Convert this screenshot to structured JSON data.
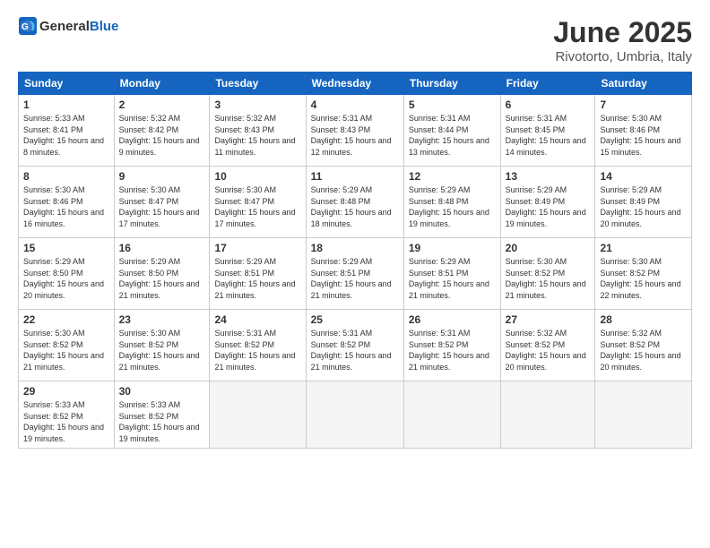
{
  "logo": {
    "general": "General",
    "blue": "Blue"
  },
  "title": "June 2025",
  "location": "Rivotorto, Umbria, Italy",
  "headers": [
    "Sunday",
    "Monday",
    "Tuesday",
    "Wednesday",
    "Thursday",
    "Friday",
    "Saturday"
  ],
  "weeks": [
    [
      {
        "day": "1",
        "rise": "5:33 AM",
        "set": "8:41 PM",
        "daylight": "15 hours and 8 minutes."
      },
      {
        "day": "2",
        "rise": "5:32 AM",
        "set": "8:42 PM",
        "daylight": "15 hours and 9 minutes."
      },
      {
        "day": "3",
        "rise": "5:32 AM",
        "set": "8:43 PM",
        "daylight": "15 hours and 11 minutes."
      },
      {
        "day": "4",
        "rise": "5:31 AM",
        "set": "8:43 PM",
        "daylight": "15 hours and 12 minutes."
      },
      {
        "day": "5",
        "rise": "5:31 AM",
        "set": "8:44 PM",
        "daylight": "15 hours and 13 minutes."
      },
      {
        "day": "6",
        "rise": "5:31 AM",
        "set": "8:45 PM",
        "daylight": "15 hours and 14 minutes."
      },
      {
        "day": "7",
        "rise": "5:30 AM",
        "set": "8:46 PM",
        "daylight": "15 hours and 15 minutes."
      }
    ],
    [
      {
        "day": "8",
        "rise": "5:30 AM",
        "set": "8:46 PM",
        "daylight": "15 hours and 16 minutes."
      },
      {
        "day": "9",
        "rise": "5:30 AM",
        "set": "8:47 PM",
        "daylight": "15 hours and 17 minutes."
      },
      {
        "day": "10",
        "rise": "5:30 AM",
        "set": "8:47 PM",
        "daylight": "15 hours and 17 minutes."
      },
      {
        "day": "11",
        "rise": "5:29 AM",
        "set": "8:48 PM",
        "daylight": "15 hours and 18 minutes."
      },
      {
        "day": "12",
        "rise": "5:29 AM",
        "set": "8:48 PM",
        "daylight": "15 hours and 19 minutes."
      },
      {
        "day": "13",
        "rise": "5:29 AM",
        "set": "8:49 PM",
        "daylight": "15 hours and 19 minutes."
      },
      {
        "day": "14",
        "rise": "5:29 AM",
        "set": "8:49 PM",
        "daylight": "15 hours and 20 minutes."
      }
    ],
    [
      {
        "day": "15",
        "rise": "5:29 AM",
        "set": "8:50 PM",
        "daylight": "15 hours and 20 minutes."
      },
      {
        "day": "16",
        "rise": "5:29 AM",
        "set": "8:50 PM",
        "daylight": "15 hours and 21 minutes."
      },
      {
        "day": "17",
        "rise": "5:29 AM",
        "set": "8:51 PM",
        "daylight": "15 hours and 21 minutes."
      },
      {
        "day": "18",
        "rise": "5:29 AM",
        "set": "8:51 PM",
        "daylight": "15 hours and 21 minutes."
      },
      {
        "day": "19",
        "rise": "5:29 AM",
        "set": "8:51 PM",
        "daylight": "15 hours and 21 minutes."
      },
      {
        "day": "20",
        "rise": "5:30 AM",
        "set": "8:52 PM",
        "daylight": "15 hours and 21 minutes."
      },
      {
        "day": "21",
        "rise": "5:30 AM",
        "set": "8:52 PM",
        "daylight": "15 hours and 22 minutes."
      }
    ],
    [
      {
        "day": "22",
        "rise": "5:30 AM",
        "set": "8:52 PM",
        "daylight": "15 hours and 21 minutes."
      },
      {
        "day": "23",
        "rise": "5:30 AM",
        "set": "8:52 PM",
        "daylight": "15 hours and 21 minutes."
      },
      {
        "day": "24",
        "rise": "5:31 AM",
        "set": "8:52 PM",
        "daylight": "15 hours and 21 minutes."
      },
      {
        "day": "25",
        "rise": "5:31 AM",
        "set": "8:52 PM",
        "daylight": "15 hours and 21 minutes."
      },
      {
        "day": "26",
        "rise": "5:31 AM",
        "set": "8:52 PM",
        "daylight": "15 hours and 21 minutes."
      },
      {
        "day": "27",
        "rise": "5:32 AM",
        "set": "8:52 PM",
        "daylight": "15 hours and 20 minutes."
      },
      {
        "day": "28",
        "rise": "5:32 AM",
        "set": "8:52 PM",
        "daylight": "15 hours and 20 minutes."
      }
    ],
    [
      {
        "day": "29",
        "rise": "5:33 AM",
        "set": "8:52 PM",
        "daylight": "15 hours and 19 minutes."
      },
      {
        "day": "30",
        "rise": "5:33 AM",
        "set": "8:52 PM",
        "daylight": "15 hours and 19 minutes."
      },
      null,
      null,
      null,
      null,
      null
    ]
  ]
}
